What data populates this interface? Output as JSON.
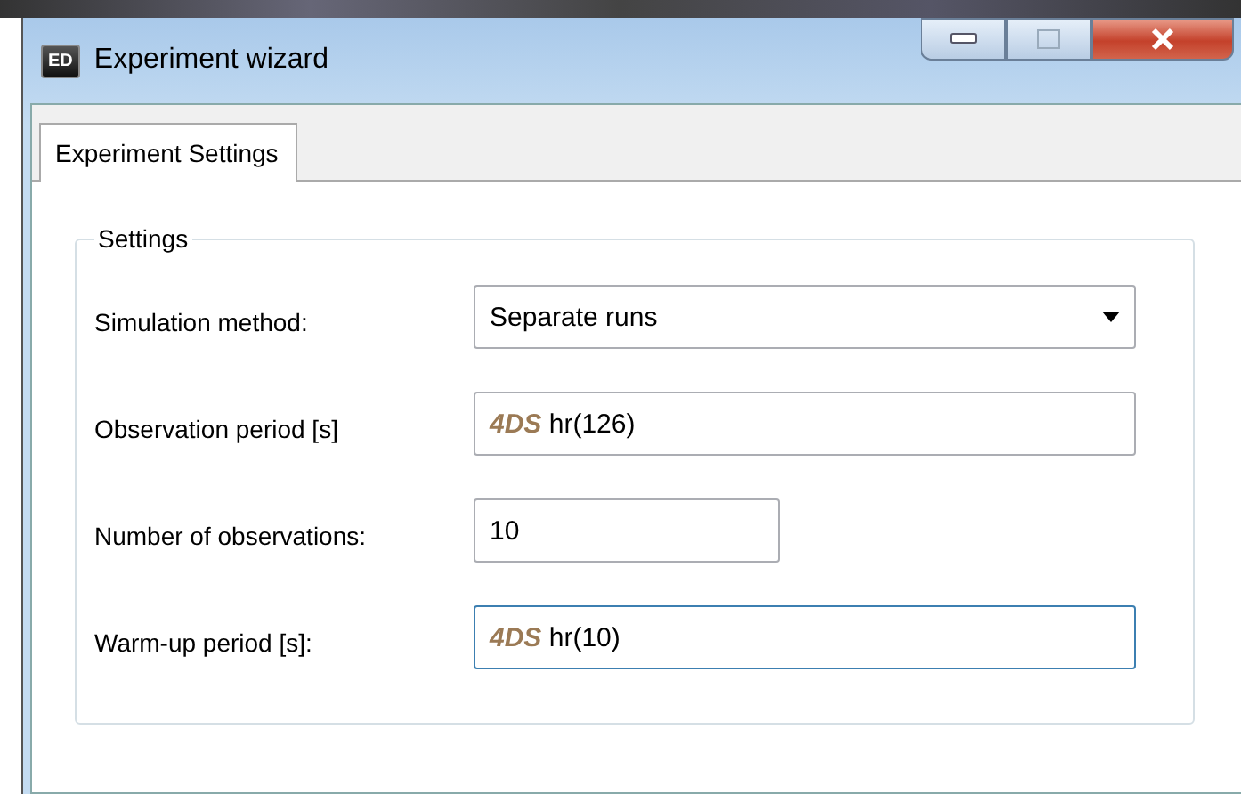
{
  "window": {
    "title": "Experiment wizard",
    "icon_text": "ED"
  },
  "tabs": [
    {
      "label": "Experiment Settings",
      "selected": true
    }
  ],
  "group": {
    "title": "Settings"
  },
  "fields": [
    {
      "kind": "dropdown",
      "label": "Simulation method:",
      "value": "Separate runs",
      "focused": false
    },
    {
      "kind": "expression",
      "label": "Observation period [s]",
      "prefix": "4DS",
      "value": "hr(126)",
      "focused": false
    },
    {
      "kind": "number",
      "label": "Number of observations:",
      "value": "10",
      "focused": false
    },
    {
      "kind": "expression",
      "label": "Warm-up period [s]:",
      "prefix": "4DS",
      "value": "hr(10)",
      "focused": true
    }
  ]
}
